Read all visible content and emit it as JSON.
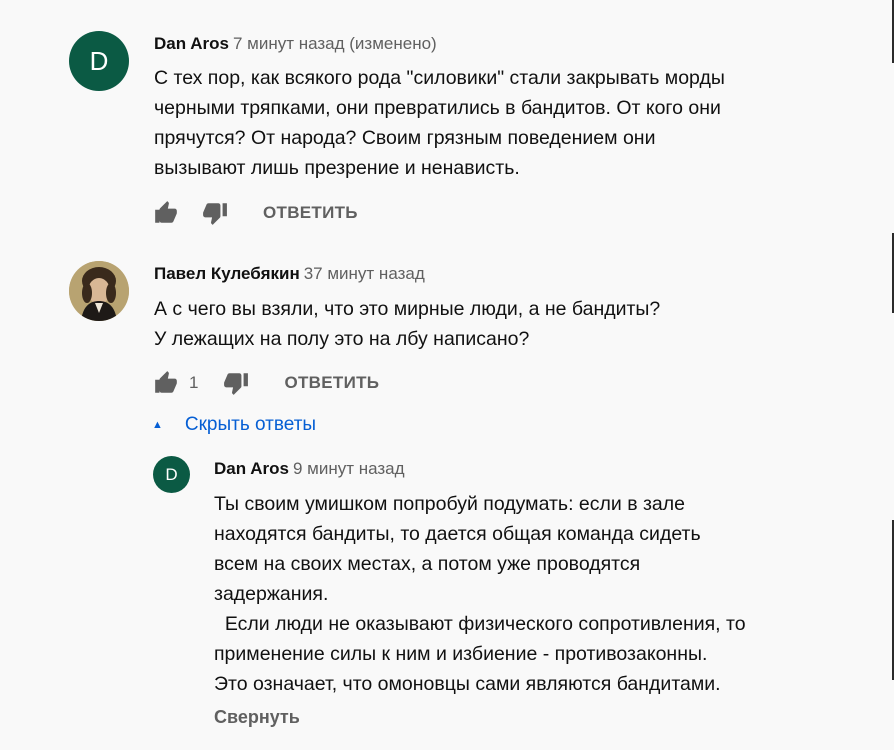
{
  "comments": [
    {
      "avatar_letter": "D",
      "avatar_color": "#0b5a44",
      "author": "Dan Aros",
      "time": "7 минут назад (изменено)",
      "text": "С тех пор, как всякого рода \"силовики\" стали закрывать морды\nчерными тряпками, они превратились в бандитов. От кого они\nпрячутся? От народа? Своим грязным поведением они\nвызывают лишь презрение и ненависть.",
      "reply_label": "ОТВЕТИТЬ"
    },
    {
      "avatar_icon": "portrait-avatar",
      "author": "Павел Кулебякин",
      "time": "37 минут назад",
      "text": "А с чего вы взяли, что это мирные люди, а не бандиты?\nУ лежащих на полу это на лбу написано?",
      "likes": "1",
      "reply_label": "ОТВЕТИТЬ",
      "hide_replies_label": "Скрыть ответы"
    }
  ],
  "reply": {
    "avatar_letter": "D",
    "avatar_color": "#0b5a44",
    "author": "Dan Aros",
    "time": "9 минут назад",
    "text": "Ты своим умишком попробуй подумать: если в зале\nнаходятся бандиты, то дается общая команда сидеть\nвсем на своих местах, а потом уже проводятся\nзадержания.\n  Если люди не оказывают физического сопротивления, то\nприменение силы к ним и избиение - противозаконны.\nЭто означает, что омоновцы сами являются бандитами.",
    "collapse_label": "Свернуть"
  },
  "colors": {
    "link_blue": "#065fd4",
    "secondary_text": "#606060",
    "background": "#f9f9f9"
  }
}
